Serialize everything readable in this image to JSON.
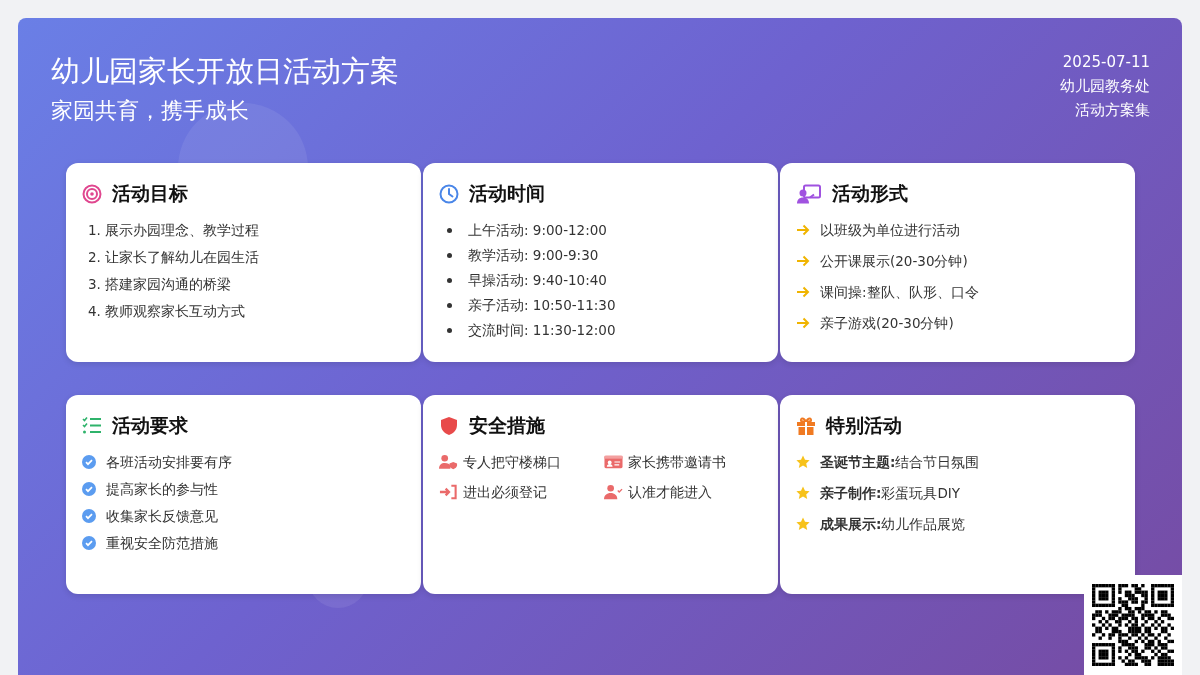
{
  "header": {
    "title": "幼儿园家长开放日活动方案",
    "subtitle": "家园共育，携手成长",
    "date": "2025-07-11",
    "department": "幼儿园教务处",
    "collection": "活动方案集"
  },
  "cards": [
    {
      "kind": "numbered",
      "title": "活动目标",
      "items": [
        "1. 展示办园理念、教学过程",
        "2. 让家长了解幼儿在园生活",
        "3. 搭建家园沟通的桥梁",
        "4. 教师观察家长互动方式"
      ]
    },
    {
      "kind": "bullets",
      "title": "活动时间",
      "items": [
        "上午活动: 9:00-12:00",
        "教学活动: 9:00-9:30",
        "早操活动: 9:40-10:40",
        "亲子活动: 10:50-11:30",
        "交流时间: 11:30-12:00"
      ]
    },
    {
      "kind": "arrows",
      "title": "活动形式",
      "items": [
        "以班级为单位进行活动",
        "公开课展示(20-30分钟)",
        "课间操:整队、队形、口令",
        "亲子游戏(20-30分钟)"
      ]
    },
    {
      "kind": "checks",
      "title": "活动要求",
      "items": [
        "各班活动安排要有序",
        "提高家长的参与性",
        "收集家长反馈意见",
        "重视安全防范措施"
      ]
    },
    {
      "kind": "grid",
      "title": "安全措施",
      "items": [
        "专人把守楼梯口",
        "家长携带邀请书",
        "进出必须登记",
        "认准才能进入"
      ]
    },
    {
      "kind": "stars",
      "title": "特别活动",
      "items": [
        "**圣诞节主题:**结合节日氛围",
        "**亲子制作:**彩蛋玩具DIY",
        "**成果展示:**幼儿作品展览"
      ]
    }
  ]
}
